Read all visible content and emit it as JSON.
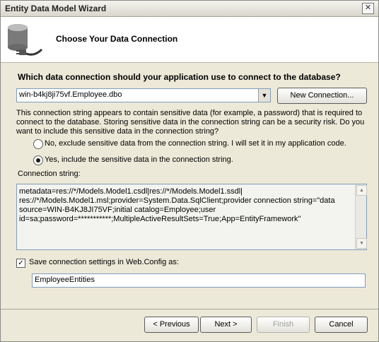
{
  "window": {
    "title": "Entity Data Model Wizard",
    "close_label": "✕"
  },
  "header": {
    "title": "Choose Your Data Connection"
  },
  "main": {
    "question": "Which data connection should your application use to connect to the database?",
    "connection_select": {
      "value": "win-b4kj8ji75vf.Employee.dbo"
    },
    "new_connection_label": "New Connection...",
    "info_text": "This connection string appears to contain sensitive data (for example, a password) that is required to connect to the database. Storing sensitive data in the connection string can be a security risk. Do you want to include this sensitive data in the connection string?",
    "radio_no_label": "No, exclude sensitive data from the connection string. I will set it in my application code.",
    "radio_yes_label": "Yes, include the sensitive data in the connection string.",
    "selected_option": "yes",
    "connection_string_label": "Connection string:",
    "connection_string": "metadata=res://*/Models.Model1.csdl|res://*/Models.Model1.ssdl|\nres://*/Models.Model1.msl;provider=System.Data.SqlClient;provider connection string=\"data source=WIN-B4KJ8JI75VF;initial catalog=Employee;user id=sa;password=***********;MultipleActiveResultSets=True;App=EntityFramework\"",
    "save_checkbox_checked": true,
    "save_label": "Save connection settings in Web.Config as:",
    "entity_name": "EmployeeEntities"
  },
  "footer": {
    "previous_label": "< Previous",
    "next_label": "Next >",
    "finish_label": "Finish",
    "cancel_label": "Cancel"
  }
}
